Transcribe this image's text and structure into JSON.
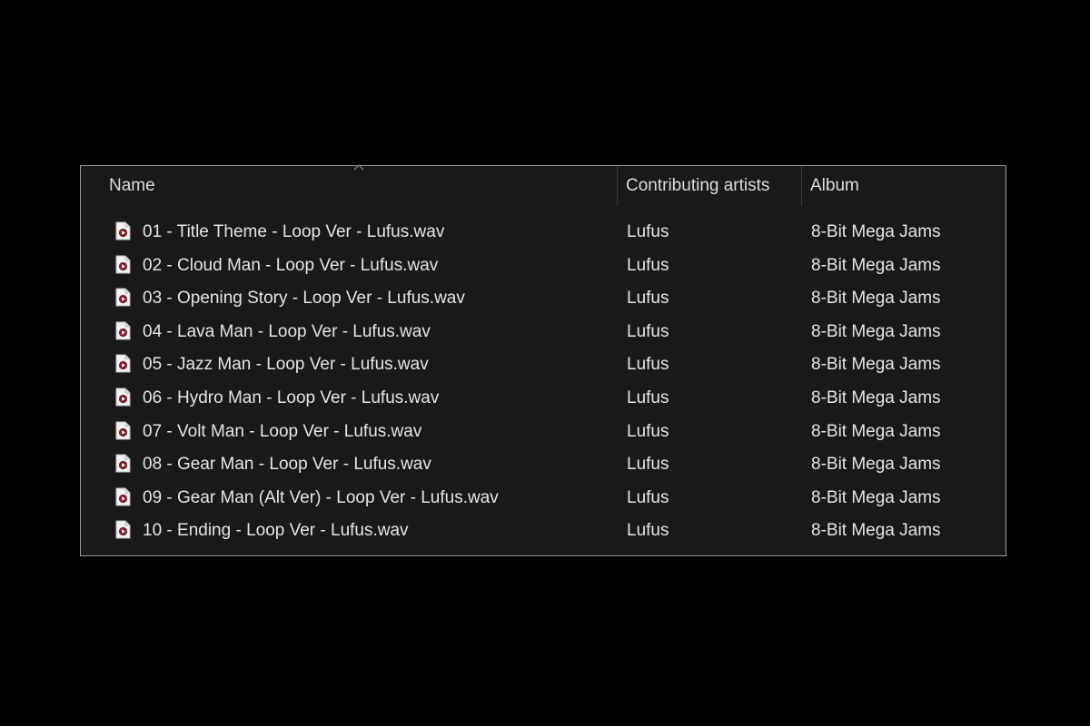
{
  "columns": {
    "name": "Name",
    "artists": "Contributing artists",
    "album": "Album"
  },
  "sort": {
    "column": "Name",
    "direction": "ascending"
  },
  "files": [
    {
      "name": "01 - Title Theme - Loop Ver - Lufus.wav",
      "artist": "Lufus",
      "album": "8-Bit Mega Jams",
      "icon": "audio-file-icon"
    },
    {
      "name": "02 - Cloud Man - Loop Ver - Lufus.wav",
      "artist": "Lufus",
      "album": "8-Bit Mega Jams",
      "icon": "audio-file-icon"
    },
    {
      "name": "03 - Opening Story - Loop Ver - Lufus.wav",
      "artist": "Lufus",
      "album": "8-Bit Mega Jams",
      "icon": "audio-file-icon"
    },
    {
      "name": "04 - Lava Man - Loop Ver - Lufus.wav",
      "artist": "Lufus",
      "album": "8-Bit Mega Jams",
      "icon": "audio-file-icon"
    },
    {
      "name": "05 - Jazz Man - Loop Ver - Lufus.wav",
      "artist": "Lufus",
      "album": "8-Bit Mega Jams",
      "icon": "audio-file-icon"
    },
    {
      "name": "06 - Hydro Man - Loop Ver - Lufus.wav",
      "artist": "Lufus",
      "album": "8-Bit Mega Jams",
      "icon": "audio-file-icon"
    },
    {
      "name": "07 - Volt Man - Loop Ver - Lufus.wav",
      "artist": "Lufus",
      "album": "8-Bit Mega Jams",
      "icon": "audio-file-icon"
    },
    {
      "name": "08 - Gear Man - Loop Ver - Lufus.wav",
      "artist": "Lufus",
      "album": "8-Bit Mega Jams",
      "icon": "audio-file-icon"
    },
    {
      "name": "09 - Gear Man (Alt Ver) - Loop Ver - Lufus.wav",
      "artist": "Lufus",
      "album": "8-Bit Mega Jams",
      "icon": "audio-file-icon"
    },
    {
      "name": "10 - Ending - Loop Ver - Lufus.wav",
      "artist": "Lufus",
      "album": "8-Bit Mega Jams",
      "icon": "audio-file-icon"
    }
  ],
  "colors": {
    "background": "#000000",
    "panel": "#191919",
    "text": "#e4e4e4",
    "icon_accent": "#7a1e2c"
  }
}
